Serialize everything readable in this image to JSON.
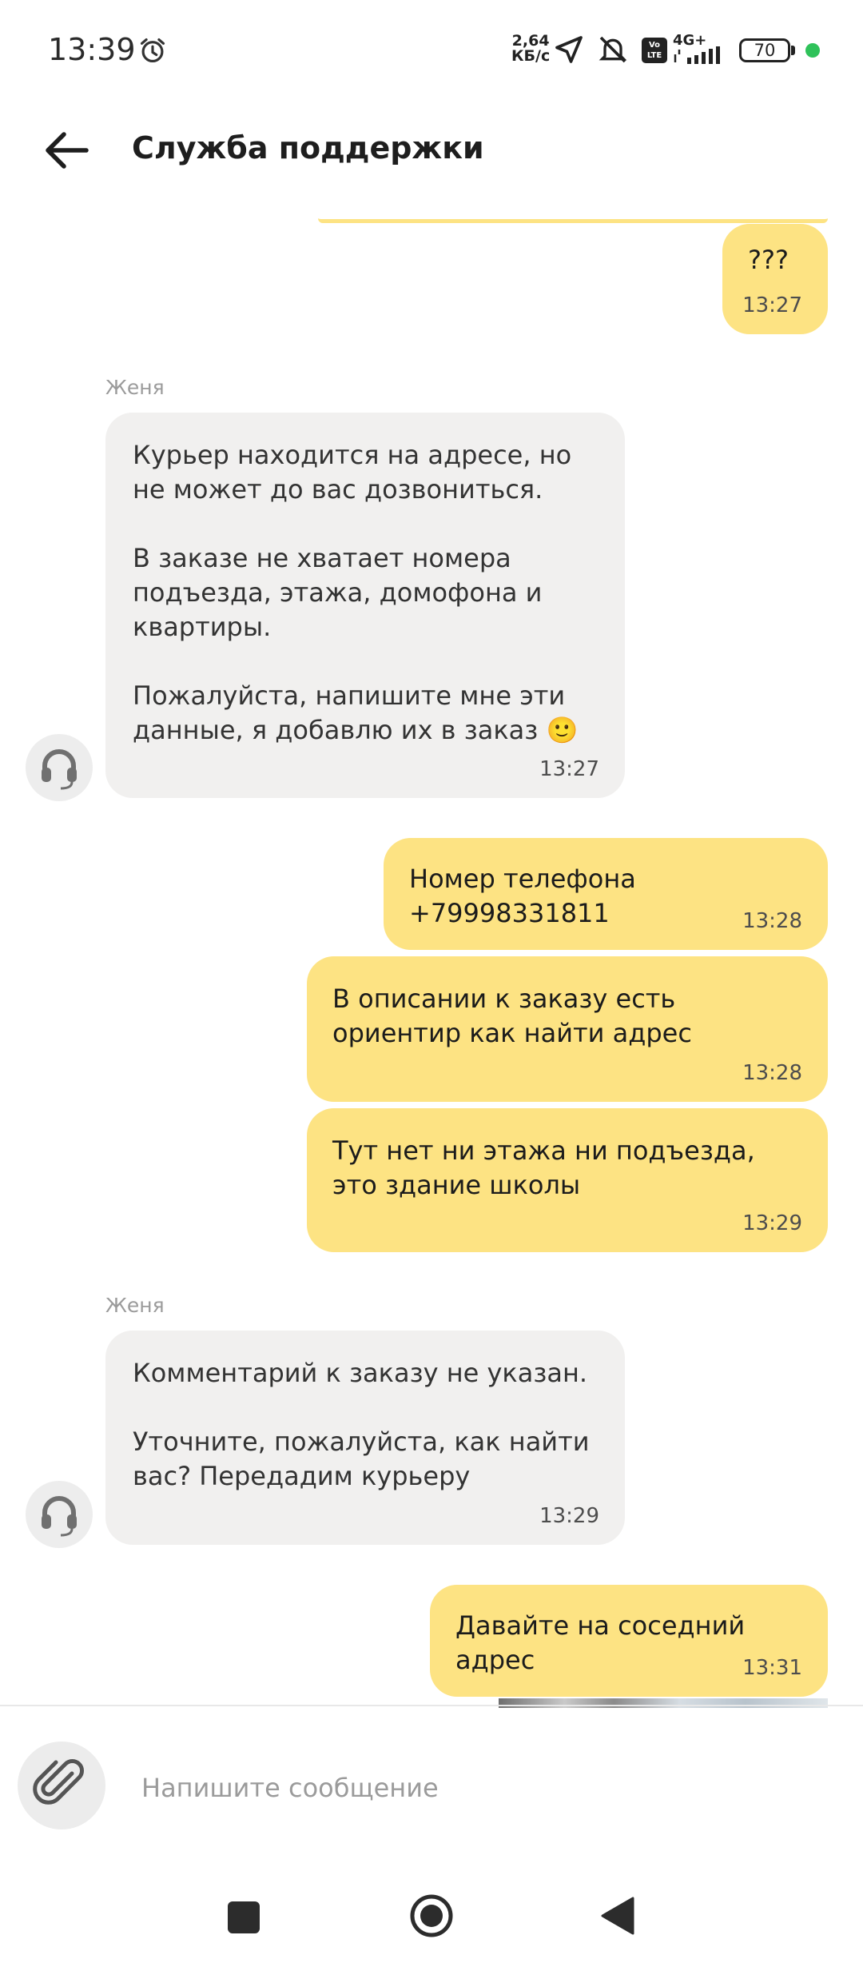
{
  "status_bar": {
    "time": "13:39",
    "speed_value": "2,64",
    "speed_unit": "КБ/с",
    "volte": "Vo LTE",
    "network": "4G+",
    "battery": "70",
    "icons": [
      "alarm-icon",
      "location-arrow-icon",
      "mute-icon",
      "volte-icon",
      "signal-icon",
      "battery-icon"
    ]
  },
  "header": {
    "title": "Служба поддержки"
  },
  "messages": [
    {
      "dir": "out",
      "text": "???",
      "time": "13:27"
    },
    {
      "dir": "in",
      "sender": "Женя",
      "text": "Курьер находится на адресе, но не может до вас дозвониться.\n\nВ заказе не хватает номера подъезда, этажа, домофона и квартиры.\n\nПожалуйста, напишите мне эти данные, я добавлю их в заказ 🙂",
      "time": "13:27"
    },
    {
      "dir": "out",
      "text": "Номер телефона +79998331811",
      "time": "13:28"
    },
    {
      "dir": "out",
      "text": "В описании к заказу есть ориентир как найти адрес",
      "time": "13:28"
    },
    {
      "dir": "out",
      "text": "Тут нет ни этажа ни подъезда, это здание школы",
      "time": "13:29"
    },
    {
      "dir": "in",
      "sender": "Женя",
      "text": "Комментарий к заказу не указан.\n\nУточните, пожалуйста, как найти вас? Передадим курьеру",
      "time": "13:29"
    },
    {
      "dir": "out",
      "text": "Давайте на соседний адрес",
      "time": "13:31"
    }
  ],
  "composer": {
    "placeholder": "Напишите сообщение"
  },
  "colors": {
    "outgoing_bubble": "#fde383",
    "incoming_bubble": "#f1f0ef",
    "online_dot": "#2fc25a"
  }
}
